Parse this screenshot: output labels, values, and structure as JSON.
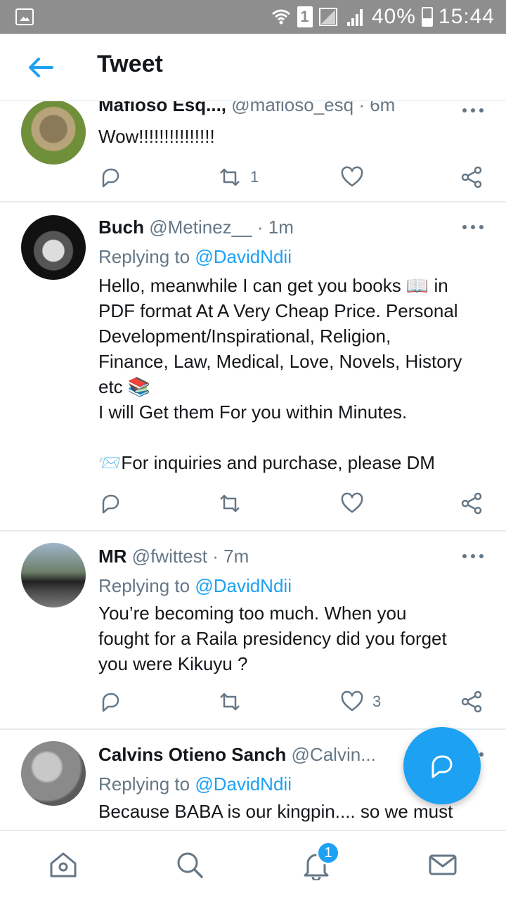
{
  "status_bar": {
    "battery_percent": "40%",
    "time": "15:44",
    "sim_label": "1"
  },
  "header": {
    "title": "Tweet"
  },
  "tweets": [
    {
      "name": "Mafioso Esq...,",
      "handle": "@mafioso_esq",
      "time": "6m",
      "replying_prefix": "",
      "replying_to": "",
      "text": "Wow!!!!!!!!!!!!!!!",
      "retweets": "1",
      "likes": ""
    },
    {
      "name": "Buch",
      "handle": "@Metinez__",
      "time": "1m",
      "replying_prefix": "Replying to",
      "replying_to": "@DavidNdii",
      "text": "Hello, meanwhile I can get you books 📖 in\nPDF format At A Very Cheap Price. Personal\nDevelopment/Inspirational, Religion,\nFinance, Law, Medical, Love, Novels, History\netc 📚\nI will Get them For you within Minutes.\n\n📨For inquiries and purchase, please DM",
      "retweets": "",
      "likes": ""
    },
    {
      "name": "MR",
      "handle": "@fwittest",
      "time": "7m",
      "replying_prefix": "Replying to",
      "replying_to": "@DavidNdii",
      "text": "You’re becoming too much. When you\nfought for a Raila presidency did you forget\nyou were Kikuyu ?",
      "retweets": "",
      "likes": "3"
    },
    {
      "name": "Calvins Otieno Sanch",
      "handle": "@Calvin...",
      "time": "",
      "replying_prefix": "Replying to",
      "replying_to": "@DavidNdii",
      "text": "Because BABA is our kingpin.... so we must",
      "retweets": "",
      "likes": ""
    }
  ],
  "bottom_nav": {
    "notifications_badge": "1",
    "items": [
      "home-icon",
      "search-icon",
      "notifications-icon",
      "messages-icon"
    ]
  },
  "colors": {
    "accent": "#1da1f2",
    "secondary_text": "#657786",
    "status_bar": "#8e8e8e"
  }
}
